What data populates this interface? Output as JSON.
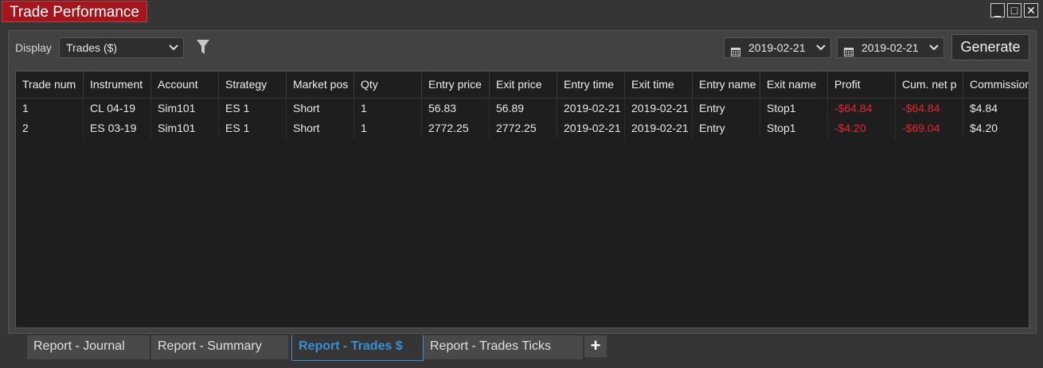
{
  "window": {
    "title": "Trade Performance",
    "controls": [
      "_",
      "□",
      "✕"
    ]
  },
  "toolbar": {
    "display_label": "Display",
    "display_value": "Trades ($)",
    "from_date": "2019-02-21",
    "to_date": "2019-02-21",
    "generate_label": "Generate"
  },
  "grid": {
    "columns": [
      "Trade num",
      "Instrument",
      "Account",
      "Strategy",
      "Market pos",
      "Qty",
      "Entry price",
      "Exit price",
      "Entry time",
      "Exit time",
      "Entry name",
      "Exit name",
      "Profit",
      "Cum. net p",
      "Commission"
    ],
    "rows": [
      [
        "1",
        "CL 04-19",
        "Sim101",
        "ES 1",
        "Short",
        "1",
        "56.83",
        "56.89",
        "2019-02-21",
        "2019-02-21",
        "Entry",
        "Stop1",
        "-$64.84",
        "-$64.84",
        "$4.84"
      ],
      [
        "2",
        "ES 03-19",
        "Sim101",
        "ES 1",
        "Short",
        "1",
        "2772.25",
        "2772.25",
        "2019-02-21",
        "2019-02-21",
        "Entry",
        "Stop1",
        "-$4.20",
        "-$69.04",
        "$4.20"
      ]
    ]
  },
  "tabs": [
    {
      "label": "Report - Journal",
      "active": false
    },
    {
      "label": "Report - Summary",
      "active": false
    },
    {
      "label": "Report - Trades $",
      "active": true
    },
    {
      "label": "Report - Trades Ticks",
      "active": false
    }
  ],
  "add_tab_label": "+",
  "colors": {
    "title_bg": "#a3161d",
    "negative": "#e3262f",
    "active_tab": "#3a8fd6"
  }
}
